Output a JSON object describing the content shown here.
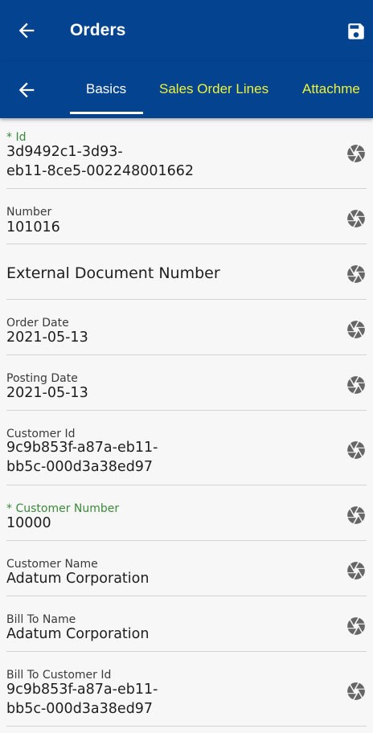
{
  "header": {
    "title": "Orders",
    "back_icon": "arrow-left-icon",
    "save_icon": "floppy-disk-icon"
  },
  "tabs": {
    "back_icon": "arrow-left-icon",
    "items": [
      {
        "label": "Basics",
        "active": true
      },
      {
        "label": "Sales Order Lines",
        "active": false
      },
      {
        "label": "Attachme",
        "active": false
      }
    ]
  },
  "fields": [
    {
      "label": "* Id",
      "required": true,
      "value": "3d9492c1-3d93-\neb11-8ce5-002248001662"
    },
    {
      "label": "Number",
      "required": false,
      "value": "101016"
    },
    {
      "label": "",
      "required": false,
      "value": "External Document Number"
    },
    {
      "label": "Order Date",
      "required": false,
      "value": "2021-05-13"
    },
    {
      "label": "Posting Date",
      "required": false,
      "value": "2021-05-13"
    },
    {
      "label": "Customer Id",
      "required": false,
      "value": "9c9b853f-a87a-eb11-\nbb5c-000d3a38ed97"
    },
    {
      "label": "* Customer Number",
      "required": true,
      "value": "10000"
    },
    {
      "label": "Customer Name",
      "required": false,
      "value": "Adatum Corporation"
    },
    {
      "label": "Bill To Name",
      "required": false,
      "value": "Adatum Corporation"
    },
    {
      "label": "Bill To Customer Id",
      "required": false,
      "value": "9c9b853f-a87a-eb11-\nbb5c-000d3a38ed97"
    }
  ],
  "colors": {
    "header_bg": "#04438f",
    "inactive_tab": "#ecf43a",
    "required_label": "#3b8a3b"
  },
  "row_icon": "camera-shutter-icon"
}
